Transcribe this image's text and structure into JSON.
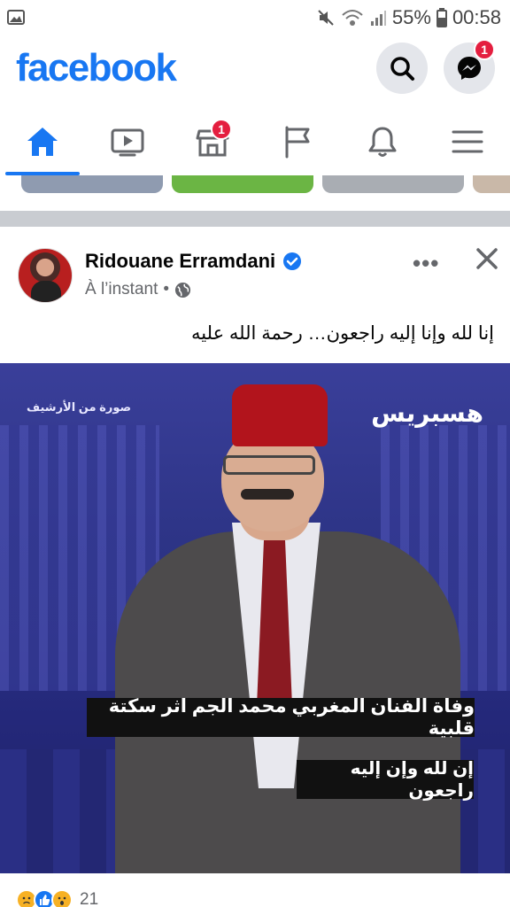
{
  "status_bar": {
    "battery": "55%",
    "time": "00:58"
  },
  "header": {
    "logo": "facebook",
    "messenger_badge": "1"
  },
  "tabs": [
    {
      "name": "home",
      "icon": "home-icon",
      "active": true
    },
    {
      "name": "watch",
      "icon": "video-icon",
      "active": false
    },
    {
      "name": "marketplace",
      "icon": "store-icon",
      "active": false,
      "badge": "1"
    },
    {
      "name": "pages",
      "icon": "flag-icon",
      "active": false
    },
    {
      "name": "notifications",
      "icon": "bell-icon",
      "active": false
    },
    {
      "name": "menu",
      "icon": "hamburger-icon",
      "active": false
    }
  ],
  "post": {
    "author": "Ridouane Erramdani",
    "verified": true,
    "time": "À l’instant",
    "more_label": "•••",
    "caption": "إنا لله وإنا إليه راجعون… رحمة الله عليه",
    "image": {
      "archive_label": "صورة من الأرشيف",
      "brand": "هسبريس",
      "subtitle_1": "وفاة الفنان المغربي محمد الجم اثر سكتة قلبية",
      "subtitle_2": "إن لله وإن إليه راجعون"
    },
    "reactions": {
      "icons": [
        "sad-reaction-icon",
        "like-reaction-icon",
        "wow-reaction-icon"
      ],
      "count": "21"
    }
  },
  "colors": {
    "brand_blue": "#1877f2",
    "badge_red": "#e41e3f",
    "icon_bg": "#e4e6eb"
  }
}
